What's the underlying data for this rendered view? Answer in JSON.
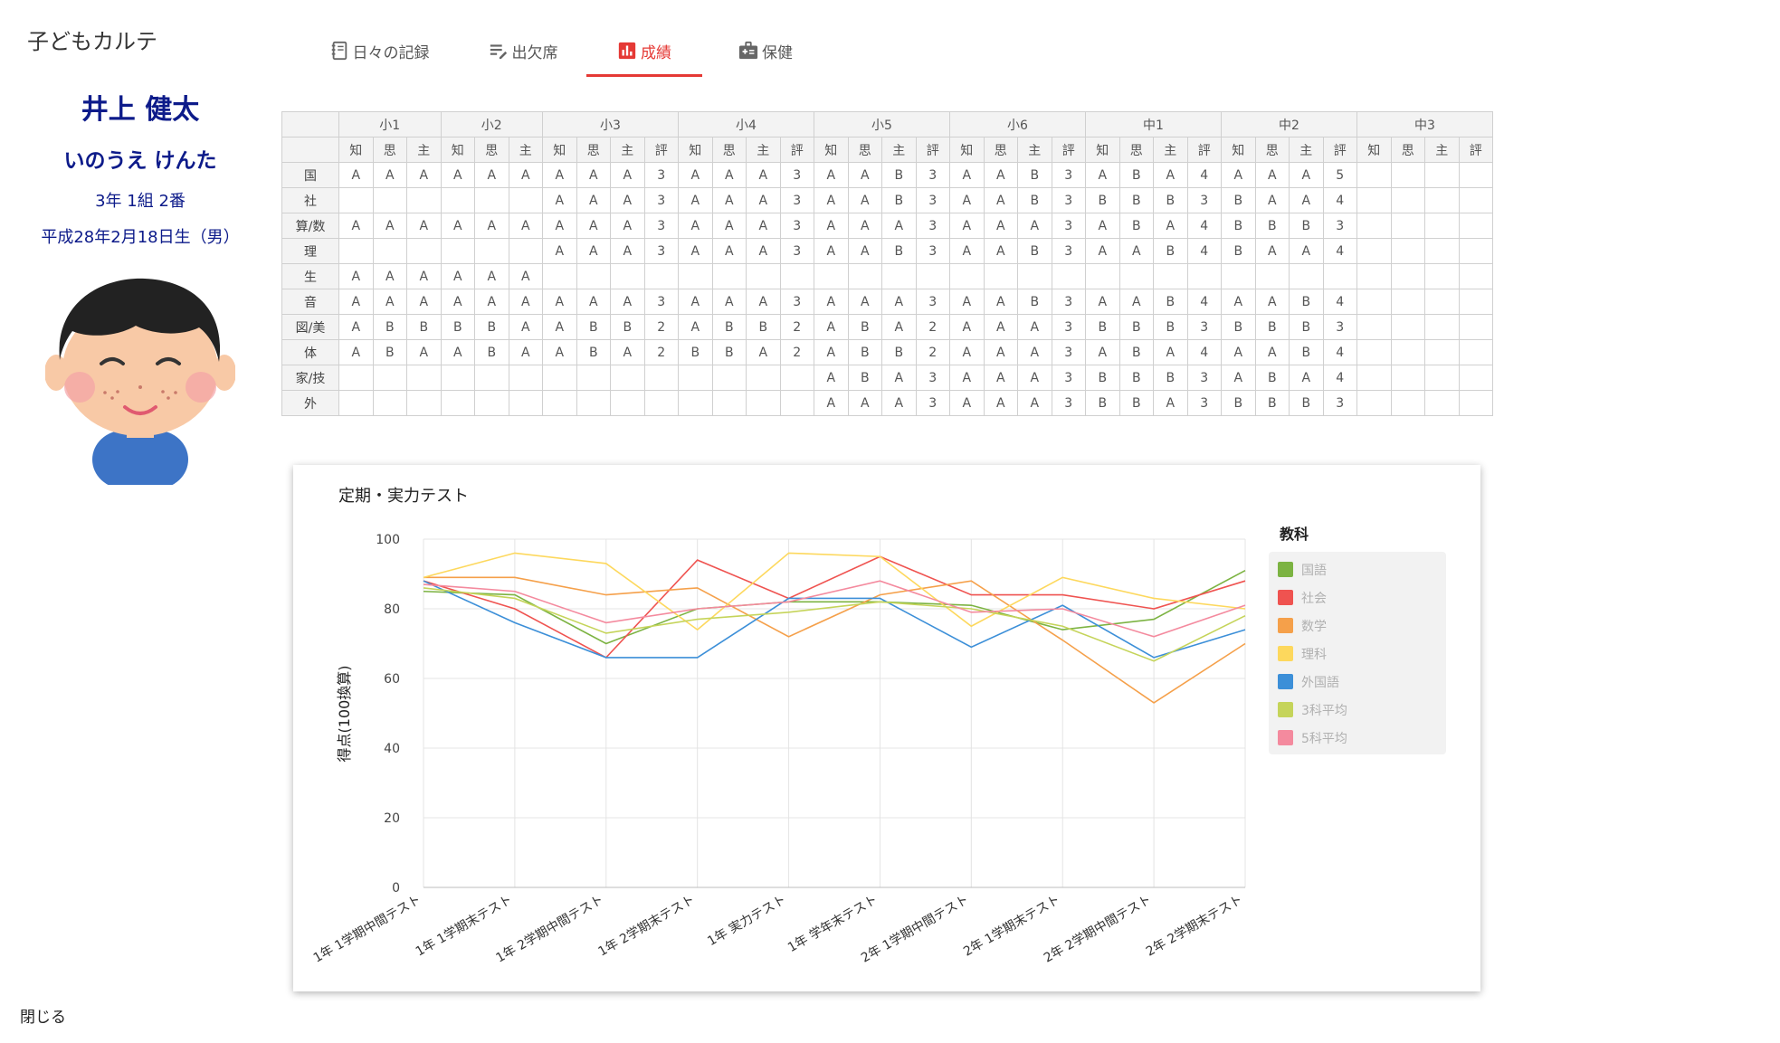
{
  "app_title": "子どもカルテ",
  "student": {
    "name": "井上 健太",
    "kana": "いのうえ けんた",
    "class_info": "3年 1組 2番",
    "birth": "平成28年2月18日生（男）"
  },
  "tabs": [
    {
      "label": "日々の記録",
      "icon": "notebook-icon",
      "active": false
    },
    {
      "label": "出欠席",
      "icon": "list-edit-icon",
      "active": false
    },
    {
      "label": "成績",
      "icon": "bar-chart-icon",
      "active": true
    },
    {
      "label": "保健",
      "icon": "medical-id-icon",
      "active": false
    }
  ],
  "close_label": "閉じる",
  "grade_table": {
    "grades": [
      {
        "label": "小1",
        "cols": [
          "知",
          "思",
          "主"
        ]
      },
      {
        "label": "小2",
        "cols": [
          "知",
          "思",
          "主"
        ]
      },
      {
        "label": "小3",
        "cols": [
          "知",
          "思",
          "主",
          "評"
        ]
      },
      {
        "label": "小4",
        "cols": [
          "知",
          "思",
          "主",
          "評"
        ]
      },
      {
        "label": "小5",
        "cols": [
          "知",
          "思",
          "主",
          "評"
        ]
      },
      {
        "label": "小6",
        "cols": [
          "知",
          "思",
          "主",
          "評"
        ]
      },
      {
        "label": "中1",
        "cols": [
          "知",
          "思",
          "主",
          "評"
        ]
      },
      {
        "label": "中2",
        "cols": [
          "知",
          "思",
          "主",
          "評"
        ]
      },
      {
        "label": "中3",
        "cols": [
          "知",
          "思",
          "主",
          "評"
        ]
      }
    ],
    "rows": [
      {
        "subject": "国",
        "cells": [
          "A",
          "A",
          "A",
          "A",
          "A",
          "A",
          "A",
          "A",
          "A",
          "3",
          "A",
          "A",
          "A",
          "3",
          "A",
          "A",
          "B",
          "3",
          "A",
          "A",
          "B",
          "3",
          "A",
          "B",
          "A",
          "4",
          "A",
          "A",
          "A",
          "5",
          "",
          "",
          "",
          ""
        ]
      },
      {
        "subject": "社",
        "cells": [
          "",
          "",
          "",
          "",
          "",
          "",
          "A",
          "A",
          "A",
          "3",
          "A",
          "A",
          "A",
          "3",
          "A",
          "A",
          "B",
          "3",
          "A",
          "A",
          "B",
          "3",
          "B",
          "B",
          "B",
          "3",
          "B",
          "A",
          "A",
          "4",
          "",
          "",
          "",
          ""
        ]
      },
      {
        "subject": "算/数",
        "cells": [
          "A",
          "A",
          "A",
          "A",
          "A",
          "A",
          "A",
          "A",
          "A",
          "3",
          "A",
          "A",
          "A",
          "3",
          "A",
          "A",
          "A",
          "3",
          "A",
          "A",
          "A",
          "3",
          "A",
          "B",
          "A",
          "4",
          "B",
          "B",
          "B",
          "3",
          "",
          "",
          "",
          ""
        ]
      },
      {
        "subject": "理",
        "cells": [
          "",
          "",
          "",
          "",
          "",
          "",
          "A",
          "A",
          "A",
          "3",
          "A",
          "A",
          "A",
          "3",
          "A",
          "A",
          "B",
          "3",
          "A",
          "A",
          "B",
          "3",
          "A",
          "A",
          "B",
          "4",
          "B",
          "A",
          "A",
          "4",
          "",
          "",
          "",
          ""
        ]
      },
      {
        "subject": "生",
        "cells": [
          "A",
          "A",
          "A",
          "A",
          "A",
          "A",
          "",
          "",
          "",
          "",
          "",
          "",
          "",
          "",
          "",
          "",
          "",
          "",
          "",
          "",
          "",
          "",
          "",
          "",
          "",
          "",
          "",
          "",
          "",
          "",
          "",
          "",
          "",
          ""
        ]
      },
      {
        "subject": "音",
        "cells": [
          "A",
          "A",
          "A",
          "A",
          "A",
          "A",
          "A",
          "A",
          "A",
          "3",
          "A",
          "A",
          "A",
          "3",
          "A",
          "A",
          "A",
          "3",
          "A",
          "A",
          "B",
          "3",
          "A",
          "A",
          "B",
          "4",
          "A",
          "A",
          "B",
          "4",
          "",
          "",
          "",
          ""
        ]
      },
      {
        "subject": "図/美",
        "cells": [
          "A",
          "B",
          "B",
          "B",
          "B",
          "A",
          "A",
          "B",
          "B",
          "2",
          "A",
          "B",
          "B",
          "2",
          "A",
          "B",
          "A",
          "2",
          "A",
          "A",
          "A",
          "3",
          "B",
          "B",
          "B",
          "3",
          "B",
          "B",
          "B",
          "3",
          "",
          "",
          "",
          ""
        ]
      },
      {
        "subject": "体",
        "cells": [
          "A",
          "B",
          "A",
          "A",
          "B",
          "A",
          "A",
          "B",
          "A",
          "2",
          "B",
          "B",
          "A",
          "2",
          "A",
          "B",
          "B",
          "2",
          "A",
          "A",
          "A",
          "3",
          "A",
          "B",
          "A",
          "4",
          "A",
          "A",
          "B",
          "4",
          "",
          "",
          "",
          ""
        ]
      },
      {
        "subject": "家/技",
        "cells": [
          "",
          "",
          "",
          "",
          "",
          "",
          "",
          "",
          "",
          "",
          "",
          "",
          "",
          "",
          "A",
          "B",
          "A",
          "3",
          "A",
          "A",
          "A",
          "3",
          "B",
          "B",
          "B",
          "3",
          "A",
          "B",
          "A",
          "4",
          "",
          "",
          "",
          ""
        ]
      },
      {
        "subject": "外",
        "cells": [
          "",
          "",
          "",
          "",
          "",
          "",
          "",
          "",
          "",
          "",
          "",
          "",
          "",
          "",
          "A",
          "A",
          "A",
          "3",
          "A",
          "A",
          "A",
          "3",
          "B",
          "B",
          "A",
          "3",
          "B",
          "B",
          "B",
          "3",
          "",
          "",
          "",
          ""
        ]
      }
    ]
  },
  "chart_data": {
    "type": "line",
    "title": "定期・実力テスト",
    "ylabel": "得点(100換算)",
    "xlabel": "",
    "ylim": [
      0,
      100
    ],
    "yticks": [
      0,
      20,
      40,
      60,
      80,
      100
    ],
    "grid": true,
    "legend_title": "教科",
    "legend_position": "right",
    "categories": [
      "1年 1学期中間テスト",
      "1年 1学期末テスト",
      "1年 2学期中間テスト",
      "1年 2学期末テスト",
      "1年 実力テスト",
      "1年 学年末テスト",
      "2年 1学期中間テスト",
      "2年 1学期末テスト",
      "2年 2学期中間テスト",
      "2年 2学期末テスト"
    ],
    "series": [
      {
        "name": "国語",
        "color": "#7cb342",
        "values": [
          85,
          84,
          70,
          80,
          82,
          82,
          81,
          74,
          77,
          91
        ]
      },
      {
        "name": "社会",
        "color": "#ef5350",
        "values": [
          88,
          80,
          66,
          94,
          83,
          95,
          84,
          84,
          80,
          88
        ]
      },
      {
        "name": "数学",
        "color": "#f5a04a",
        "values": [
          89,
          89,
          84,
          86,
          72,
          84,
          88,
          71,
          53,
          70
        ]
      },
      {
        "name": "理科",
        "color": "#fdd85d",
        "values": [
          89,
          96,
          93,
          74,
          96,
          95,
          75,
          89,
          83,
          80
        ]
      },
      {
        "name": "外国語",
        "color": "#3c8fd8",
        "values": [
          88,
          76,
          66,
          66,
          83,
          83,
          69,
          81,
          66,
          74
        ]
      },
      {
        "name": "3科平均",
        "color": "#c5d45a",
        "values": [
          86,
          83,
          73,
          77,
          79,
          82,
          80,
          75,
          65,
          78
        ]
      },
      {
        "name": "5科平均",
        "color": "#f48a9e",
        "values": [
          87,
          85,
          76,
          80,
          82,
          88,
          79,
          80,
          72,
          81
        ]
      }
    ]
  }
}
